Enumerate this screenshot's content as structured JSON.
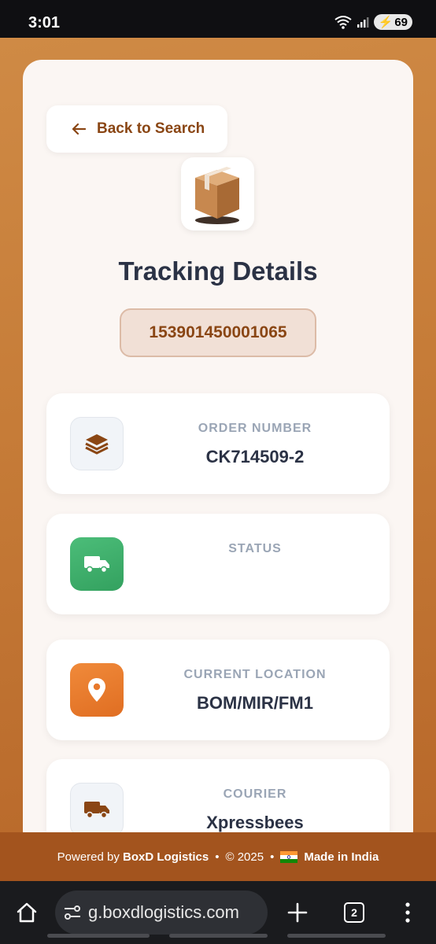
{
  "status_bar": {
    "time": "3:01",
    "battery": "69"
  },
  "header": {
    "back_label": "Back to Search"
  },
  "main": {
    "title": "Tracking Details",
    "tracking_number": "153901450001065",
    "cards": [
      {
        "label": "ORDER NUMBER",
        "value": "CK714509-2",
        "icon": "layers-icon"
      },
      {
        "label": "STATUS",
        "value": "",
        "icon": "truck-icon"
      },
      {
        "label": "CURRENT LOCATION",
        "value": "BOM/MIR/FM1",
        "icon": "location-pin-icon"
      },
      {
        "label": "COURIER",
        "value": "Xpressbees",
        "icon": "truck-icon"
      }
    ]
  },
  "footer": {
    "powered_by": "Powered by",
    "brand": "BoxD Logistics",
    "sep1": "•",
    "copyright": "© 2025",
    "sep2": "•",
    "made_in": "Made in India"
  },
  "browser": {
    "url": "g.boxdlogistics.com",
    "tab_count": "2"
  },
  "colors": {
    "accent": "#8a4614",
    "green": "#3daa68",
    "orange": "#e8792c",
    "text": "#2b3245"
  }
}
